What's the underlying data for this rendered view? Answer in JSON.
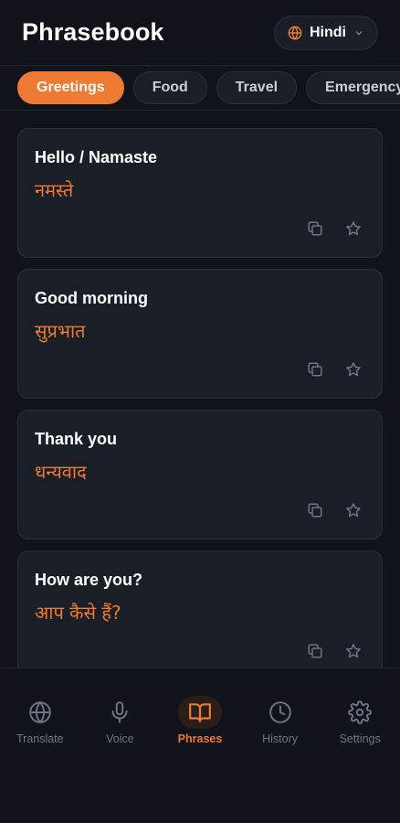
{
  "header": {
    "title": "Phrasebook",
    "language": "Hindi"
  },
  "tabs": [
    {
      "label": "Greetings",
      "active": true
    },
    {
      "label": "Food",
      "active": false
    },
    {
      "label": "Travel",
      "active": false
    },
    {
      "label": "Emergency",
      "active": false
    }
  ],
  "phrases": [
    {
      "en": "Hello / Namaste",
      "tr": "नमस्ते"
    },
    {
      "en": "Good morning",
      "tr": "सुप्रभात"
    },
    {
      "en": "Thank you",
      "tr": "धन्यवाद"
    },
    {
      "en": "How are you?",
      "tr": "आप कैसे हैं?"
    }
  ],
  "nav": [
    {
      "label": "Translate",
      "icon": "globe-icon",
      "active": false
    },
    {
      "label": "Voice",
      "icon": "microphone-icon",
      "active": false
    },
    {
      "label": "Phrases",
      "icon": "book-icon",
      "active": true
    },
    {
      "label": "History",
      "icon": "clock-icon",
      "active": false
    },
    {
      "label": "Settings",
      "icon": "gear-icon",
      "active": false
    }
  ],
  "colors": {
    "accent": "#ee7a33",
    "background": "#10131a",
    "card": "#1a1e27",
    "muted": "#6e7584"
  }
}
